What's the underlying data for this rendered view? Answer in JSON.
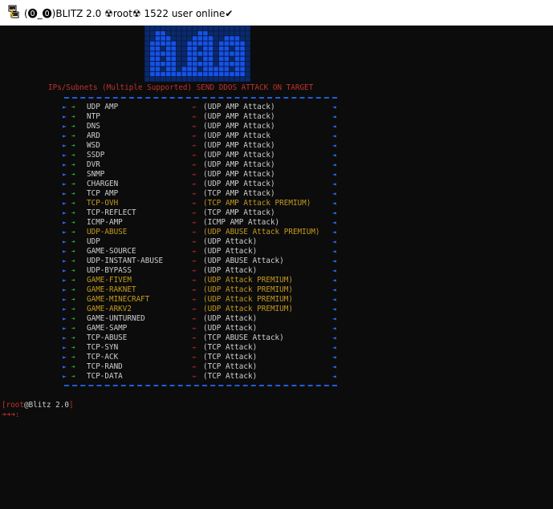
{
  "window": {
    "title": "(⓿_⓿)BLITZ 2.0 ☢root☢ 1522 user online✔"
  },
  "banner": {
    "heading": "IPs/Subnets (Multiple Supported) SEND DDOS ATTACK ON  TARGET"
  },
  "methods": [
    {
      "name": "UDP AMP",
      "desc": "(UDP AMP Attack)",
      "premium": false
    },
    {
      "name": "NTP",
      "desc": "(UDP AMP Attack)",
      "premium": false
    },
    {
      "name": "DNS",
      "desc": "(UDP AMP Attack)",
      "premium": false
    },
    {
      "name": "ARD",
      "desc": "(UDP AMP Attack",
      "premium": false
    },
    {
      "name": "WSD",
      "desc": "(UDP AMP Attack)",
      "premium": false
    },
    {
      "name": "SSDP",
      "desc": "(UDP AMP Attack)",
      "premium": false
    },
    {
      "name": "DVR",
      "desc": "(UDP AMP Attack)",
      "premium": false
    },
    {
      "name": "SNMP",
      "desc": "(UDP AMP Attack)",
      "premium": false
    },
    {
      "name": "CHARGEN",
      "desc": "(UDP AMP Attack)",
      "premium": false
    },
    {
      "name": "TCP AMP",
      "desc": "(TCP AMP Attack)",
      "premium": false
    },
    {
      "name": "TCP-OVH",
      "desc": "(TCP AMP Attack PREMIUM)",
      "premium": true
    },
    {
      "name": "TCP-REFLECT",
      "desc": "(TCP AMP Attack)",
      "premium": false
    },
    {
      "name": "ICMP-AMP",
      "desc": "(ICMP AMP Attack)",
      "premium": false
    },
    {
      "name": "UDP-ABUSE",
      "desc": "(UDP ABUSE Attack PREMIUM)",
      "premium": true
    },
    {
      "name": "UDP",
      "desc": "(UDP Attack)",
      "premium": false
    },
    {
      "name": "GAME-SOURCE",
      "desc": "(UDP Attack)",
      "premium": false
    },
    {
      "name": "UDP-INSTANT-ABUSE",
      "desc": "(UDP ABUSE Attack)",
      "premium": false
    },
    {
      "name": "UDP-BYPASS",
      "desc": "(UDP Attack)",
      "premium": false
    },
    {
      "name": "GAME-FIVEM",
      "desc": "(UDP Attack PREMIUM)",
      "premium": true
    },
    {
      "name": "GAME-RAKNET",
      "desc": "(UDP Attack PREMIUM)",
      "premium": true
    },
    {
      "name": "GAME-MINECRAFT",
      "desc": "(UDP Attack PREMIUM)",
      "premium": true
    },
    {
      "name": "GAME-ARKV2",
      "desc": "(UDP Attack PREMIUM)",
      "premium": true
    },
    {
      "name": "GAME-UNTURNED",
      "desc": "(UDP Attack)",
      "premium": false
    },
    {
      "name": "GAME-SAMP",
      "desc": "(UDP Attack)",
      "premium": false
    },
    {
      "name": "TCP-ABUSE",
      "desc": "(TCP ABUSE Attack)",
      "premium": false
    },
    {
      "name": "TCP-SYN",
      "desc": "(TCP Attack)",
      "premium": false
    },
    {
      "name": "TCP-ACK",
      "desc": "(TCP Attack)",
      "premium": false
    },
    {
      "name": "TCP-RAND",
      "desc": "(TCP Attack)",
      "premium": false
    },
    {
      "name": "TCP-DATA",
      "desc": "(TCP Attack)",
      "premium": false
    }
  ],
  "prompt": {
    "open_bracket": "[",
    "user": "root",
    "host": "@Blitz 2.0",
    "close_bracket": "]",
    "input_marker": "➜➜➜:"
  },
  "colors": {
    "background": "#0c0c0c",
    "text": "#cfcfcf",
    "premium": "#c49a1f",
    "red": "#c0312b",
    "blue": "#1e5fd7",
    "green": "#2fbf3a"
  },
  "icons": {
    "app": "putty-terminal-icon",
    "logo": "blue-pixel-logo"
  }
}
